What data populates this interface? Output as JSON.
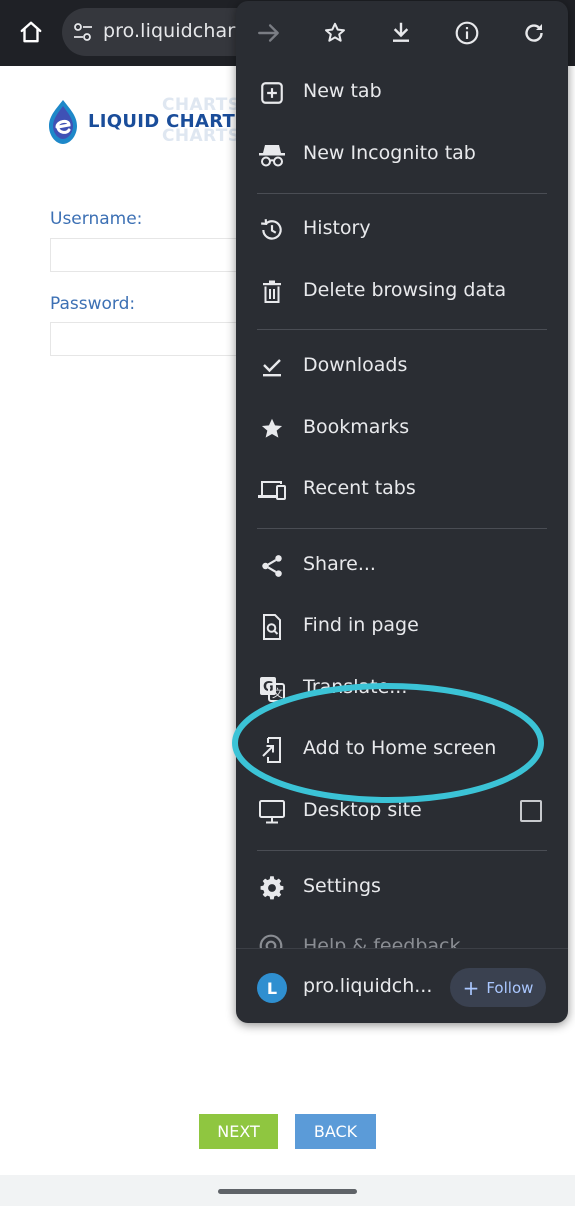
{
  "browser": {
    "url": "pro.liquidcharts.com"
  },
  "page": {
    "logo": {
      "text": "LIQUID CHARTS",
      "ghost_text": "CHARTS"
    },
    "username_label": "Username:",
    "password_label": "Password:",
    "next_label": "NEXT",
    "back_label": "BACK"
  },
  "menu": {
    "toolbar": [
      {
        "name": "forward",
        "icon": "arrow-right-icon"
      },
      {
        "name": "bookmark",
        "icon": "star-outline-icon"
      },
      {
        "name": "download",
        "icon": "download-icon"
      },
      {
        "name": "page-info",
        "icon": "info-icon"
      },
      {
        "name": "refresh",
        "icon": "refresh-icon"
      }
    ],
    "items": [
      {
        "label": "New tab",
        "icon": "new-tab-icon"
      },
      {
        "label": "New Incognito tab",
        "icon": "incognito-icon"
      },
      {
        "label": "History",
        "icon": "history-icon"
      },
      {
        "label": "Delete browsing data",
        "icon": "trash-icon"
      },
      {
        "label": "Downloads",
        "icon": "downloads-check-icon"
      },
      {
        "label": "Bookmarks",
        "icon": "star-icon"
      },
      {
        "label": "Recent tabs",
        "icon": "devices-icon"
      },
      {
        "label": "Share...",
        "icon": "share-icon"
      },
      {
        "label": "Find in page",
        "icon": "find-in-page-icon"
      },
      {
        "label": "Translate...",
        "icon": "translate-icon"
      },
      {
        "label": "Add to Home screen",
        "icon": "add-to-home-icon"
      },
      {
        "label": "Desktop site",
        "icon": "desktop-icon",
        "checked": false
      },
      {
        "label": "Settings",
        "icon": "gear-icon"
      },
      {
        "label": "Help & feedback",
        "icon": "help-icon"
      }
    ],
    "footer": {
      "avatar_letter": "L",
      "site_name": "pro.liquidch...",
      "follow_label": "Follow"
    }
  },
  "colors": {
    "highlight": "#3bc3d6",
    "menu_bg": "#2a2d33",
    "next_btn": "#8fc640",
    "back_btn": "#5b9bd8"
  }
}
